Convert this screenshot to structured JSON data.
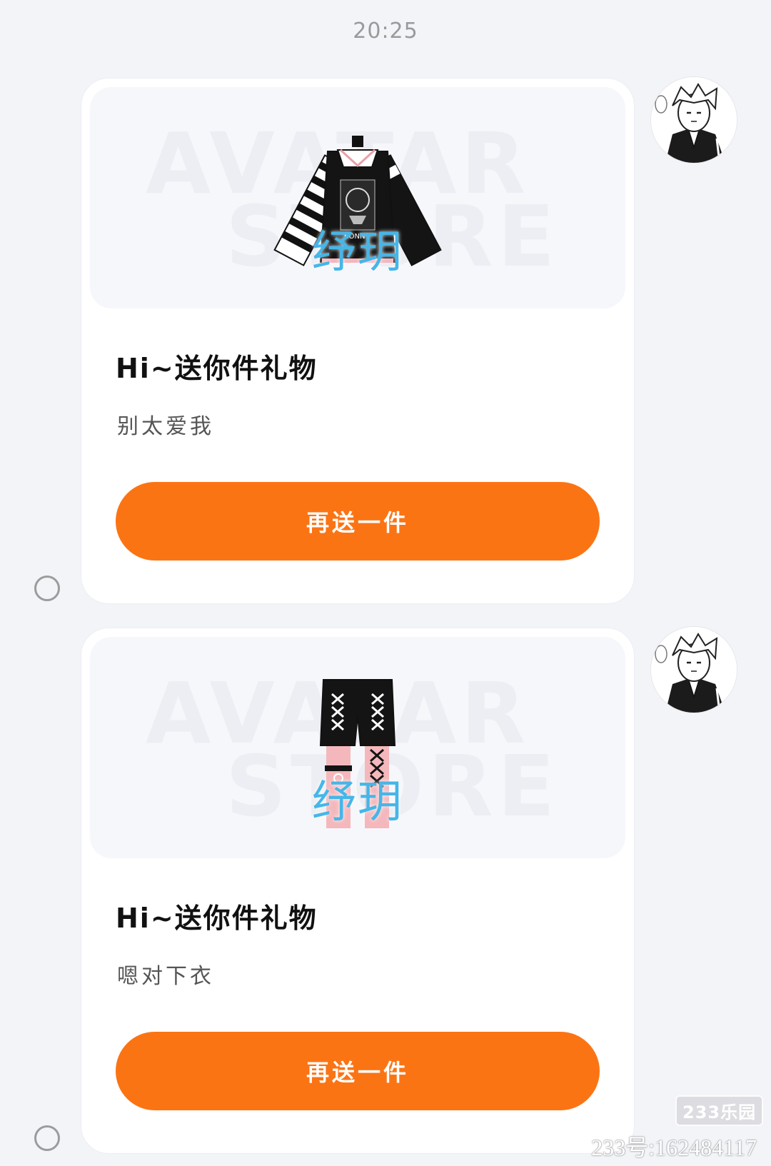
{
  "timestamp": "20:25",
  "gifts": [
    {
      "preview": {
        "watermark_line1": "AVATAR",
        "watermark_line2": "STORE",
        "item_icon": "striped-hoodie-icon",
        "seller_stamp": "纾玥"
      },
      "title": "Hi~送你件礼物",
      "message": "别太爱我",
      "button_label": "再送一件"
    },
    {
      "preview": {
        "watermark_line1": "AVATAR",
        "watermark_line2": "STORE",
        "item_icon": "lace-up-shorts-icon",
        "seller_stamp": "纾玥"
      },
      "title": "Hi~送你件礼物",
      "message": "嗯对下衣",
      "button_label": "再送一件"
    }
  ],
  "sender_avatar": "anime-character-avatar",
  "colors": {
    "button": "#fb7414",
    "stamp": "#46b6e8",
    "background": "#f3f4f8"
  },
  "watermark": {
    "badge": "233乐园",
    "id_text": "233号:162484117"
  }
}
